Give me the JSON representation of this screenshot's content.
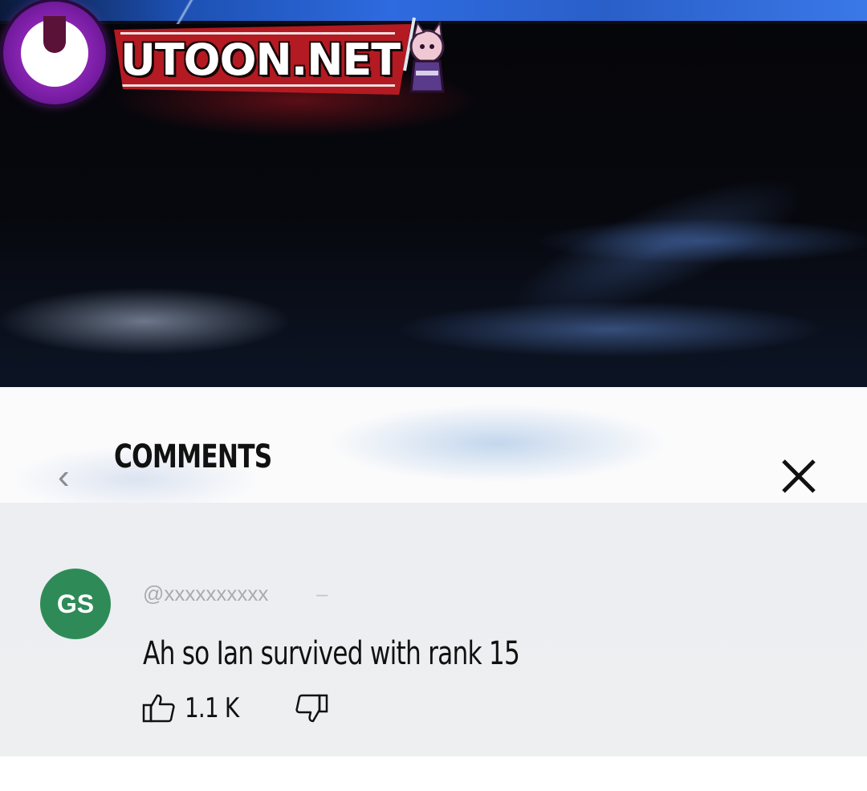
{
  "logo": {
    "text": "UTOON.NET"
  },
  "comments_panel": {
    "title": "COMMENTS",
    "back_icon": "chevron-left-icon",
    "close_icon": "close-icon"
  },
  "comment": {
    "avatar_initials": "GS",
    "avatar_color": "#2e8b57",
    "handle": "@xxxxxxxxxx",
    "handle_suffix": "–",
    "text": "Ah so Ian survived with rank 15",
    "like_icon": "thumbs-up-icon",
    "like_count": "1.1 K",
    "dislike_icon": "thumbs-down-icon"
  }
}
